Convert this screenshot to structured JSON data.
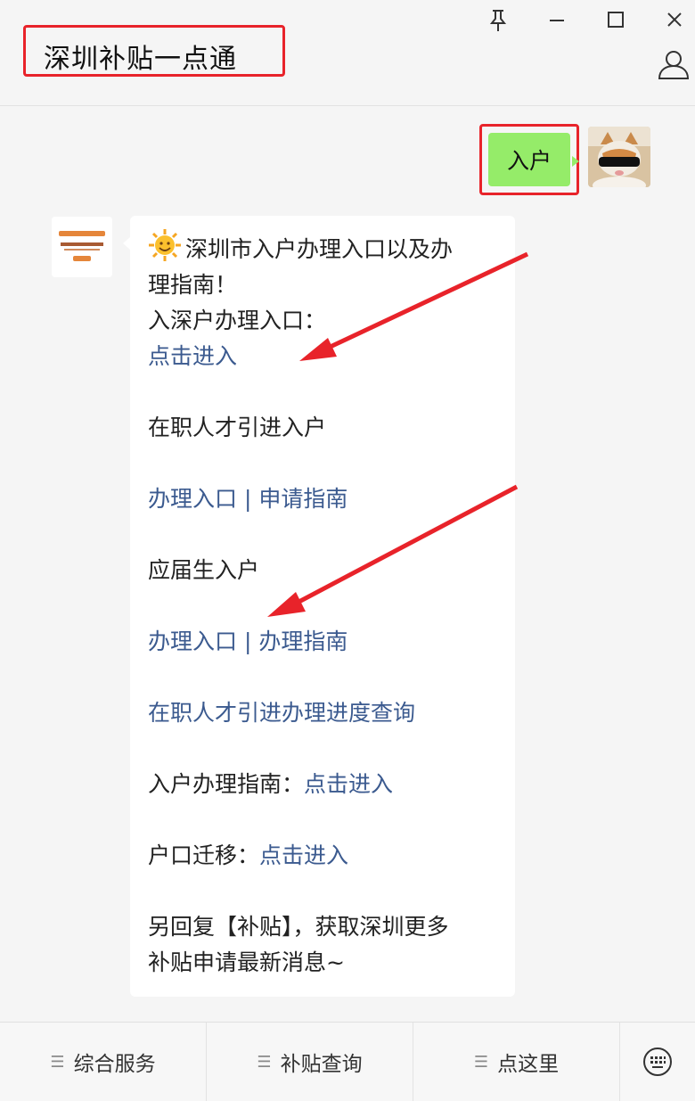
{
  "window": {
    "title": "深圳补贴一点通",
    "pin_icon": "pin-icon",
    "minimize_icon": "minimize-icon",
    "maximize_icon": "maximize-icon",
    "close_icon": "close-icon",
    "profile_icon": "person-icon"
  },
  "colors": {
    "highlight": "#e8232a",
    "my_bubble": "#95ec69",
    "link": "#3b5a8f",
    "arrow": "#e8232a"
  },
  "messages": {
    "user": {
      "text": "入户"
    },
    "bot": {
      "intro_line1": "深圳市入户办理入口以及办",
      "intro_line2": "理指南！",
      "entry_label": "入深户办理入口：",
      "entry_link": "点击进入",
      "talent_title": "在职人才引进入户",
      "talent_link_apply": "办理入口",
      "talent_separator": " | ",
      "talent_link_guide": "申请指南",
      "graduate_title": "应届生入户",
      "graduate_link_apply": "办理入口",
      "graduate_separator": " | ",
      "graduate_link_guide": "办理指南",
      "talent_progress_link": "在职人才引进办理进度查询",
      "guide_label": "入户办理指南：",
      "guide_link": "点击进入",
      "migration_label": "户口迁移：",
      "migration_link": "点击进入",
      "footer_line1": "另回复【补贴】，获取深圳更多",
      "footer_line2": "补贴申请最新消息~"
    }
  },
  "bottom_menu": {
    "items": [
      {
        "label": "综合服务",
        "icon": "menu-lines-icon"
      },
      {
        "label": "补贴查询",
        "icon": "menu-lines-icon"
      },
      {
        "label": "点这里",
        "icon": "menu-lines-icon"
      }
    ],
    "keyboard_icon": "keyboard-icon"
  }
}
